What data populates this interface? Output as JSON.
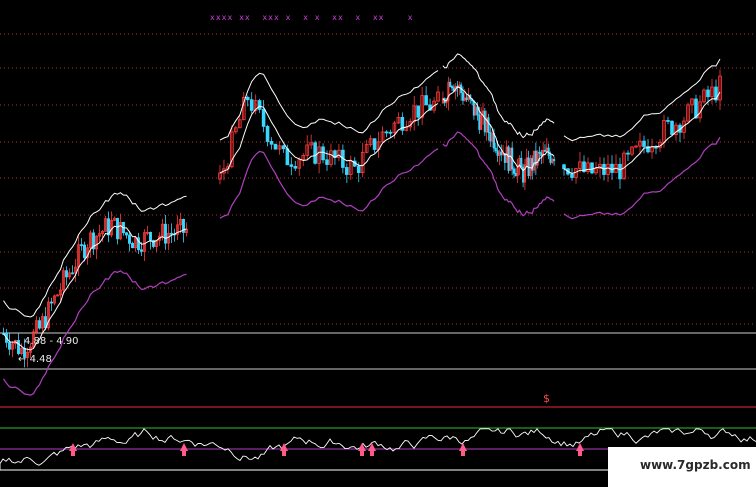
{
  "chart_data": {
    "type": "candlestick",
    "price_labels": {
      "range": "4.88 - 4.90",
      "low": "4.48"
    },
    "top_markers": "xxxx xx  xxx x  x x  xx  x  xx    x",
    "indicator_marker": "$",
    "colors": {
      "up": "#ff3a3a",
      "down": "#39d7ff",
      "ma": "#ffffff",
      "lower_band": "#b040c0",
      "grid": "#b03030",
      "signal": "#ff5a8a"
    },
    "segments": [
      {
        "candles": 62,
        "start": 4.6,
        "path": [
          [
            0,
            4.6
          ],
          [
            6,
            4.52
          ],
          [
            12,
            4.62
          ],
          [
            20,
            4.85
          ],
          [
            28,
            5.05
          ],
          [
            36,
            5.13
          ],
          [
            44,
            5.05
          ],
          [
            52,
            5.08
          ],
          [
            61,
            5.1
          ]
        ]
      },
      {
        "candles": 56,
        "start": 5.35,
        "path": [
          [
            0,
            5.35
          ],
          [
            7,
            5.75
          ],
          [
            10,
            5.65
          ],
          [
            16,
            5.45
          ],
          [
            25,
            5.48
          ],
          [
            34,
            5.4
          ],
          [
            40,
            5.55
          ],
          [
            48,
            5.68
          ],
          [
            55,
            5.72
          ]
        ]
      },
      {
        "candles": 62,
        "start": 5.72,
        "path": [
          [
            0,
            5.72
          ],
          [
            4,
            5.85
          ],
          [
            12,
            5.75
          ],
          [
            20,
            5.65
          ],
          [
            28,
            5.55
          ],
          [
            36,
            5.45
          ],
          [
            44,
            5.38
          ],
          [
            52,
            5.45
          ],
          [
            61,
            5.48
          ]
        ]
      },
      {
        "candles": 40,
        "start": 5.42,
        "path": [
          [
            0,
            5.42
          ],
          [
            6,
            5.38
          ],
          [
            14,
            5.4
          ],
          [
            22,
            5.55
          ],
          [
            30,
            5.65
          ],
          [
            39,
            5.8
          ]
        ]
      }
    ],
    "indicator_signals": [
      73,
      184,
      284,
      362,
      372,
      463,
      580
    ],
    "ylim": [
      4.3,
      6.1
    ]
  },
  "watermark": "www.7gpzb.com"
}
